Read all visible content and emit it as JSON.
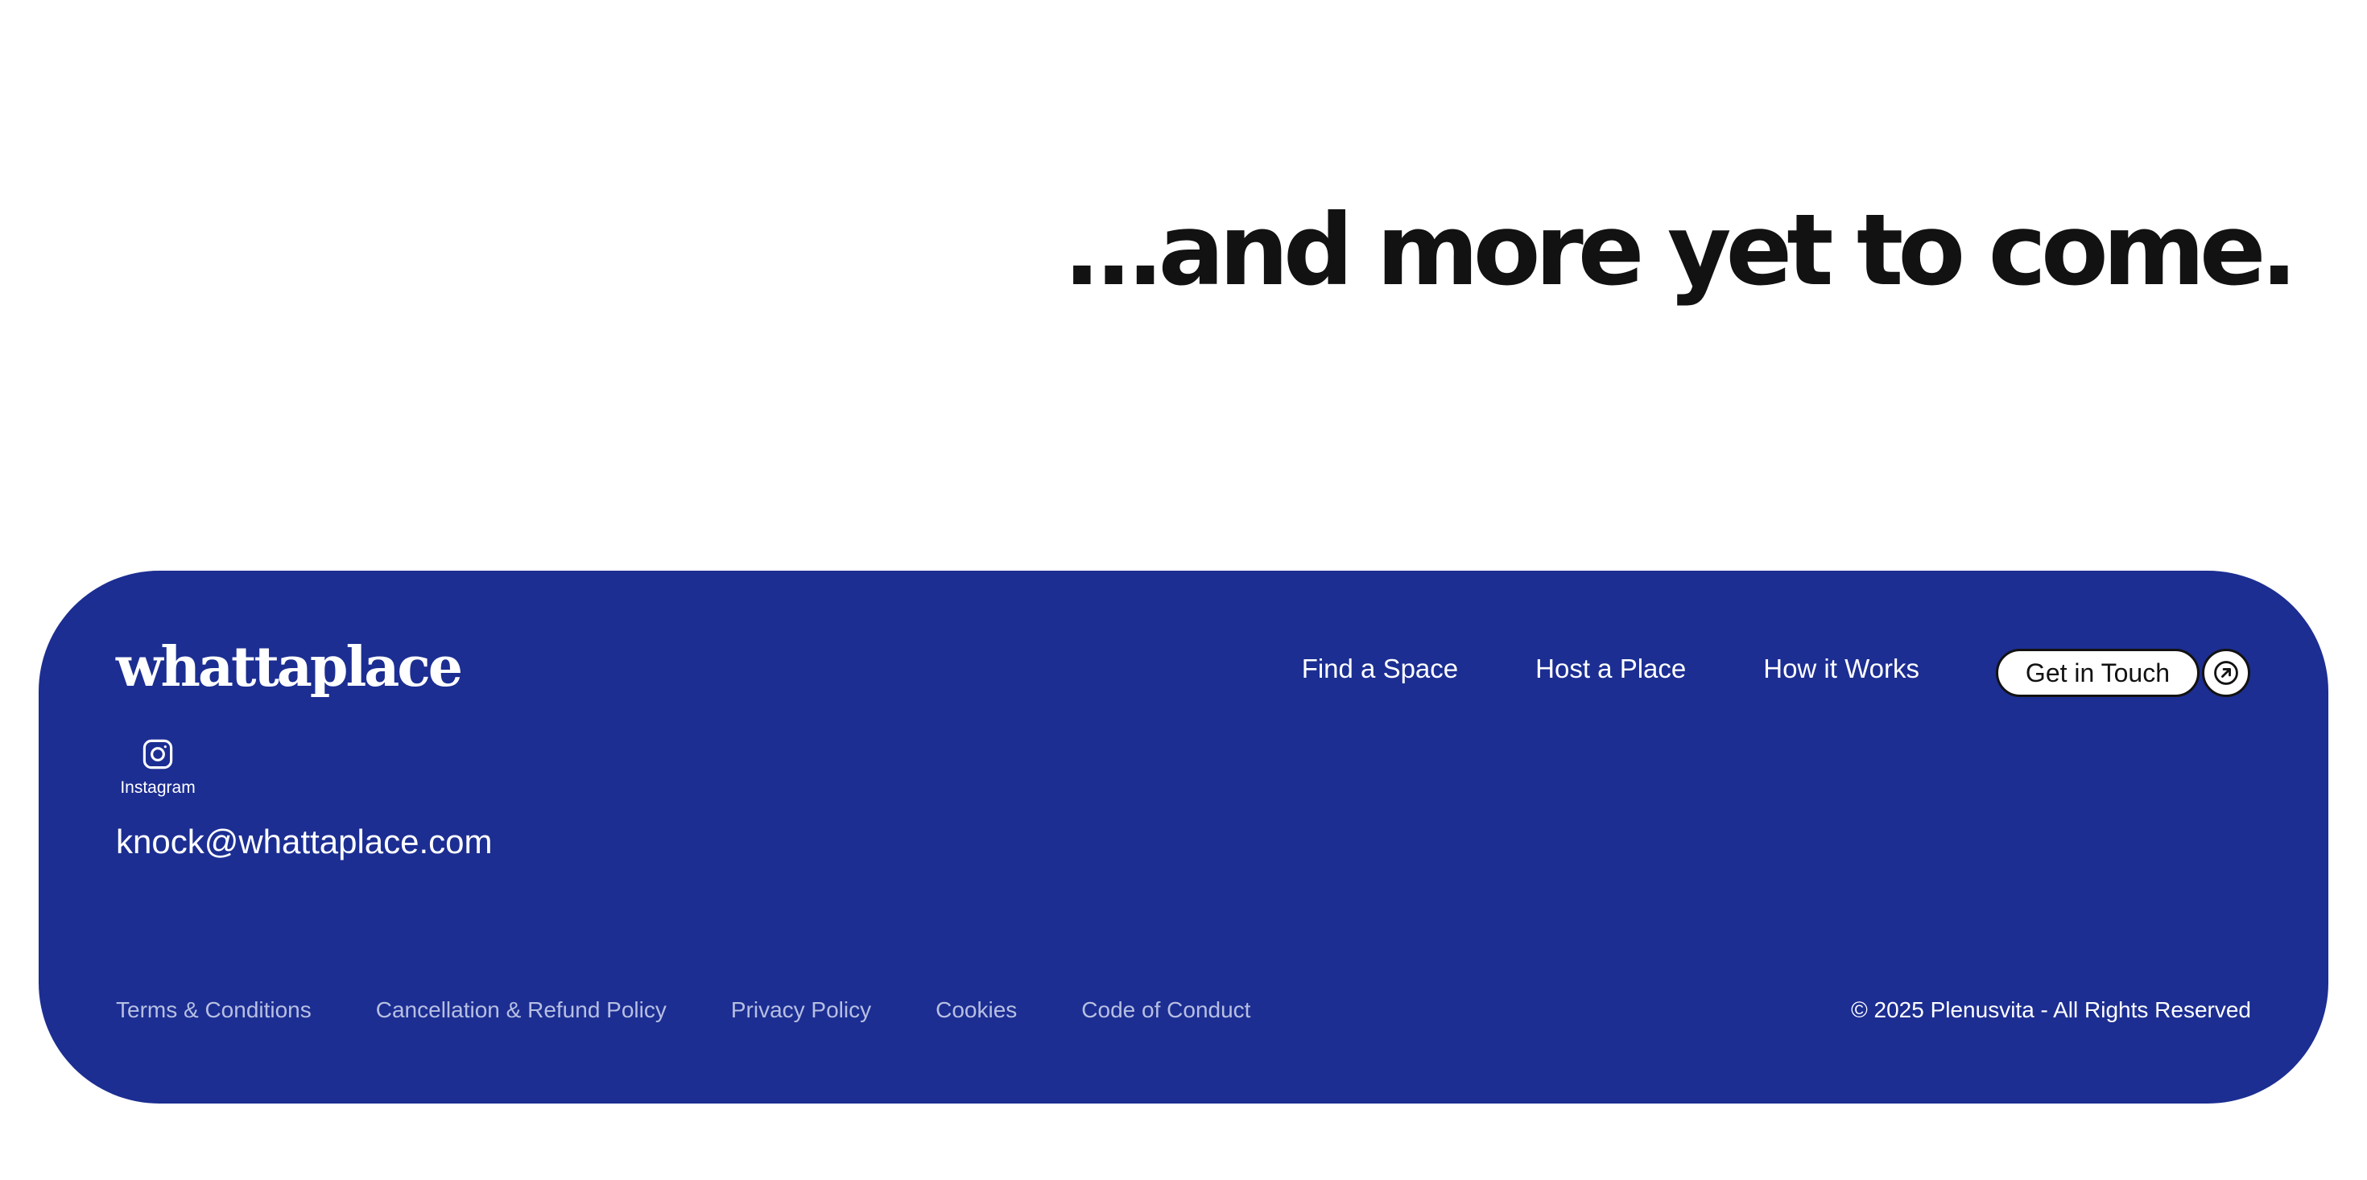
{
  "hero": {
    "headline": "...and more yet to come."
  },
  "footer": {
    "logo": "whattaplace",
    "nav": {
      "items": [
        {
          "label": "Find a Space"
        },
        {
          "label": "Host a Place"
        },
        {
          "label": "How it Works"
        }
      ]
    },
    "cta": {
      "label": "Get in Touch",
      "icon": "arrow-up-right-circle-icon"
    },
    "social": {
      "icon": "instagram-icon",
      "label": "Instagram"
    },
    "email": "knock@whattaplace.com",
    "legal": {
      "links": [
        {
          "label": "Terms & Conditions"
        },
        {
          "label": "Cancellation & Refund Policy"
        },
        {
          "label": "Privacy Policy"
        },
        {
          "label": "Cookies"
        },
        {
          "label": "Code of Conduct"
        }
      ]
    },
    "copyright": "© 2025 Plenusvita - All Rights Reserved"
  },
  "colors": {
    "footer_background": "#1c2e92",
    "headline_text": "#121212",
    "legal_text": "#b7bfe2",
    "white": "#ffffff"
  }
}
